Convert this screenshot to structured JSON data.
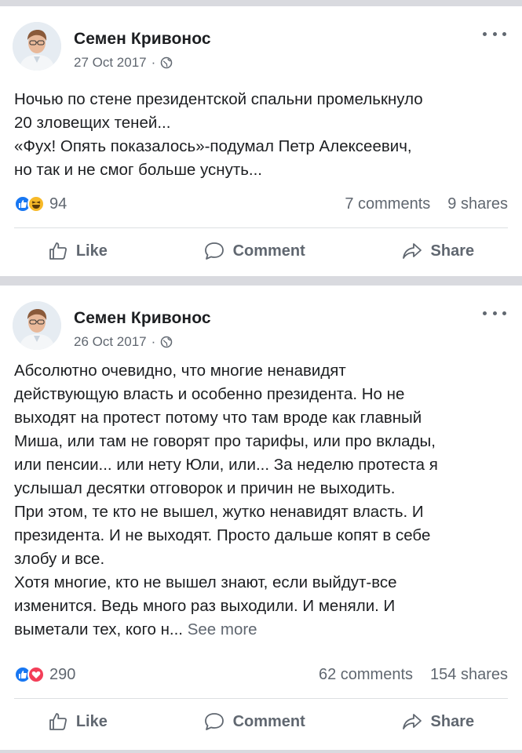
{
  "posts": [
    {
      "author": "Семен Кривонос",
      "date": "27 Oct 2017",
      "text": [
        "Ночью по стене президентской спальни промелькнуло",
        "20 зловещих теней...",
        "«Фух! Опять показалось»-подумал Петр Алексеевич,",
        "но так и не смог больше уснуть..."
      ],
      "reaction_count": "94",
      "reactions": [
        "like-icon",
        "haha-icon"
      ],
      "comments": "7 comments",
      "shares": "9 shares"
    },
    {
      "author": "Семен Кривонос",
      "date": "26 Oct 2017",
      "text": [
        "Абсолютно очевидно, что многие ненавидят",
        "действующую власть и особенно президента. Но не",
        "выходят на протест потому что там вроде как главный",
        "Миша, или там не говорят про тарифы, или про вклады,",
        "или пенсии... или нету Юли, или... За неделю протеста я",
        "услышал десятки отговорок и причин не выходить.",
        "При этом, те кто не вышел, жутко ненавидят власть. И",
        "президента. И не выходят. Просто дальше копят в себе",
        "злобу и все.",
        "Хотя многие, кто не вышел знают, если выйдут-все",
        "изменится. Ведь много раз выходили. И меняли. И"
      ],
      "last_line": "выметали тех, кого н...",
      "see_more": "See more",
      "reaction_count": "290",
      "reactions": [
        "like-icon",
        "love-icon"
      ],
      "comments": "62 comments",
      "shares": "154 shares"
    }
  ],
  "actions": {
    "like": "Like",
    "comment": "Comment",
    "share": "Share"
  },
  "colors": {
    "background": "#d9dadf",
    "card": "#ffffff",
    "secondary_text": "#606770",
    "like_blue": "#1877f2",
    "haha_yellow": "#f7b928",
    "love_red": "#f33e58"
  }
}
